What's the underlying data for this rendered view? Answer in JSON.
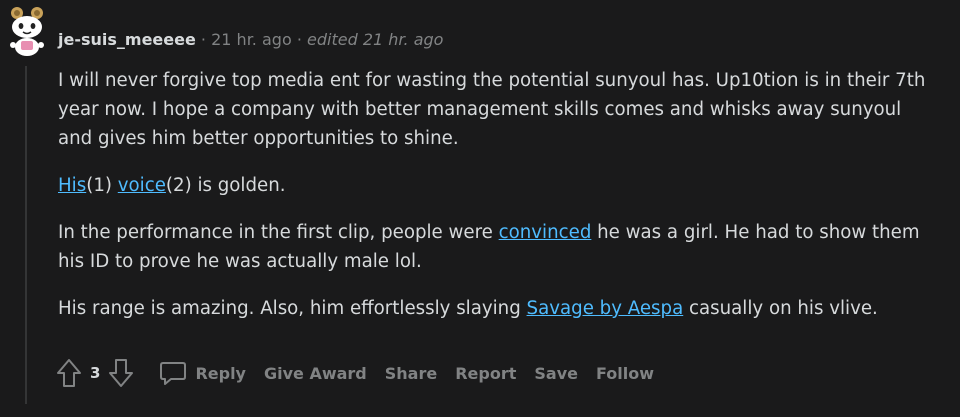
{
  "comment": {
    "username": "je-suis_meeeee",
    "separator": "·",
    "time": "21 hr. ago",
    "edited": "edited 21 hr. ago",
    "paragraphs": [
      {
        "text": "I will never forgive top media ent for wasting the potential sunyoul has. Up10tion is in their 7th year now. I hope a company with better management skills comes and whisks away sunyoul and gives him better opportunities to shine."
      },
      {
        "link1": "His",
        "ref1": "(1) ",
        "link2": "voice",
        "ref2": "(2) is golden."
      },
      {
        "before": "In the performance in the first clip, people were ",
        "link": "convinced",
        "after": " he was a girl. He had to show them his ID to prove he was actually male lol."
      },
      {
        "before": "His range is amazing. Also, him effortlessly slaying ",
        "link": "Savage by Aespa",
        "after": " casually on his vlive."
      }
    ],
    "score": "3"
  },
  "actions": {
    "reply": "Reply",
    "give_award": "Give Award",
    "share": "Share",
    "report": "Report",
    "save": "Save",
    "follow": "Follow"
  },
  "icons": {
    "upvote": "upvote-arrow-icon",
    "downvote": "downvote-arrow-icon",
    "reply": "speech-bubble-icon",
    "avatar": "snoo-avatar"
  },
  "colors": {
    "background": "#1a1a1b",
    "text": "#d7dadc",
    "muted": "#818384",
    "link": "#4fbcff"
  }
}
